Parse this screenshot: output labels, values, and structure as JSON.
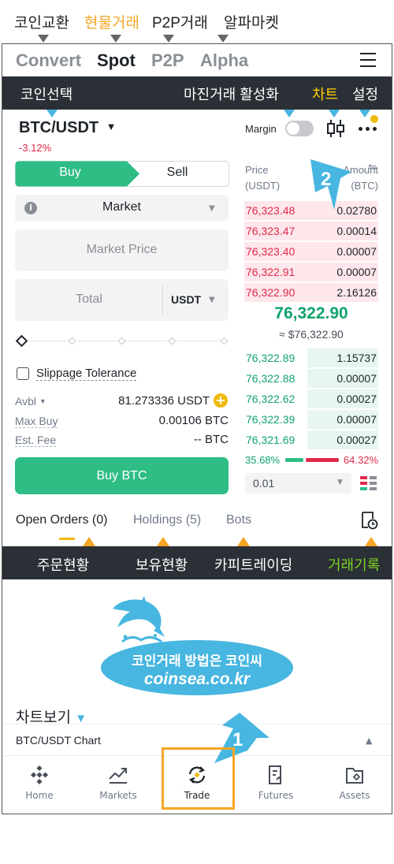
{
  "annot_top": {
    "coin_exchange": "코인교환",
    "spot_trade": "현물거래",
    "p2p_trade": "P2P거래",
    "alpha_market": "알파마켓"
  },
  "main_tabs": [
    "Convert",
    "Spot",
    "P2P",
    "Alpha"
  ],
  "annot_bar1": {
    "coin_select": "코인선택",
    "margin_activate": "마진거래 활성화",
    "chart": "차트",
    "settings": "설정"
  },
  "pair": {
    "symbol": "BTC/USDT",
    "change": "-3.12%",
    "margin_label": "Margin"
  },
  "order_form": {
    "buy_tab": "Buy",
    "sell_tab": "Sell",
    "order_type": "Market",
    "market_price_placeholder": "Market Price",
    "total_placeholder": "Total",
    "total_unit": "USDT",
    "slippage_label": "Slippage Tolerance",
    "avbl_label": "Avbl",
    "avbl_value": "81.273336 USDT",
    "max_buy_label": "Max Buy",
    "max_buy_value": "0.00106 BTC",
    "est_fee_label": "Est. Fee",
    "est_fee_value": "-- BTC",
    "submit_label": "Buy BTC"
  },
  "orderbook": {
    "price_header": "Price\n(USDT)",
    "amount_header": "Amount\n(BTC)",
    "asks": [
      {
        "price": "76,323.48",
        "amount": "0.02780",
        "depth": 1.0
      },
      {
        "price": "76,323.47",
        "amount": "0.00014",
        "depth": 1.0
      },
      {
        "price": "76,323.40",
        "amount": "0.00007",
        "depth": 1.0
      },
      {
        "price": "76,322.91",
        "amount": "0.00007",
        "depth": 1.0
      },
      {
        "price": "76,322.90",
        "amount": "2.16126",
        "depth": 1.0
      }
    ],
    "last_price": "76,322.90",
    "last_price_usd": "≈ $76,322.90",
    "bids": [
      {
        "price": "76,322.89",
        "amount": "1.15737",
        "depth": 0.53
      },
      {
        "price": "76,322.88",
        "amount": "0.00007",
        "depth": 0.53
      },
      {
        "price": "76,322.62",
        "amount": "0.00027",
        "depth": 0.53
      },
      {
        "price": "76,322.39",
        "amount": "0.00007",
        "depth": 0.53
      },
      {
        "price": "76,321.69",
        "amount": "0.00027",
        "depth": 0.53
      }
    ],
    "buy_ratio": "35.68%",
    "sell_ratio": "64.32%",
    "buy_ratio_value": 35.68,
    "precision": "0.01"
  },
  "bottom_tabs": {
    "open_orders": "Open Orders (0)",
    "holdings": "Holdings (5)",
    "bots": "Bots"
  },
  "annot_bar2": {
    "order_status": "주문현황",
    "holding_status": "보유현황",
    "copy_trading": "카피트레이딩",
    "trade_history": "거래기록"
  },
  "watermark": {
    "slogan": "코인거래 방법은 코인씨",
    "domain": "coinsea.co.kr"
  },
  "chart_view_label": "차트보기",
  "chart_section_title": "BTC/USDT Chart",
  "callouts": {
    "one": "1",
    "two": "2"
  },
  "nav": [
    "Home",
    "Markets",
    "Trade",
    "Futures",
    "Assets"
  ],
  "colors": {
    "buy_green": "#2ebd85",
    "sell_red": "#e0294a",
    "annotation_orange": "#f5a623",
    "annotation_blue": "#47b6e0",
    "annotation_yellow": "#ffd400",
    "annotation_green": "#7ed321"
  }
}
